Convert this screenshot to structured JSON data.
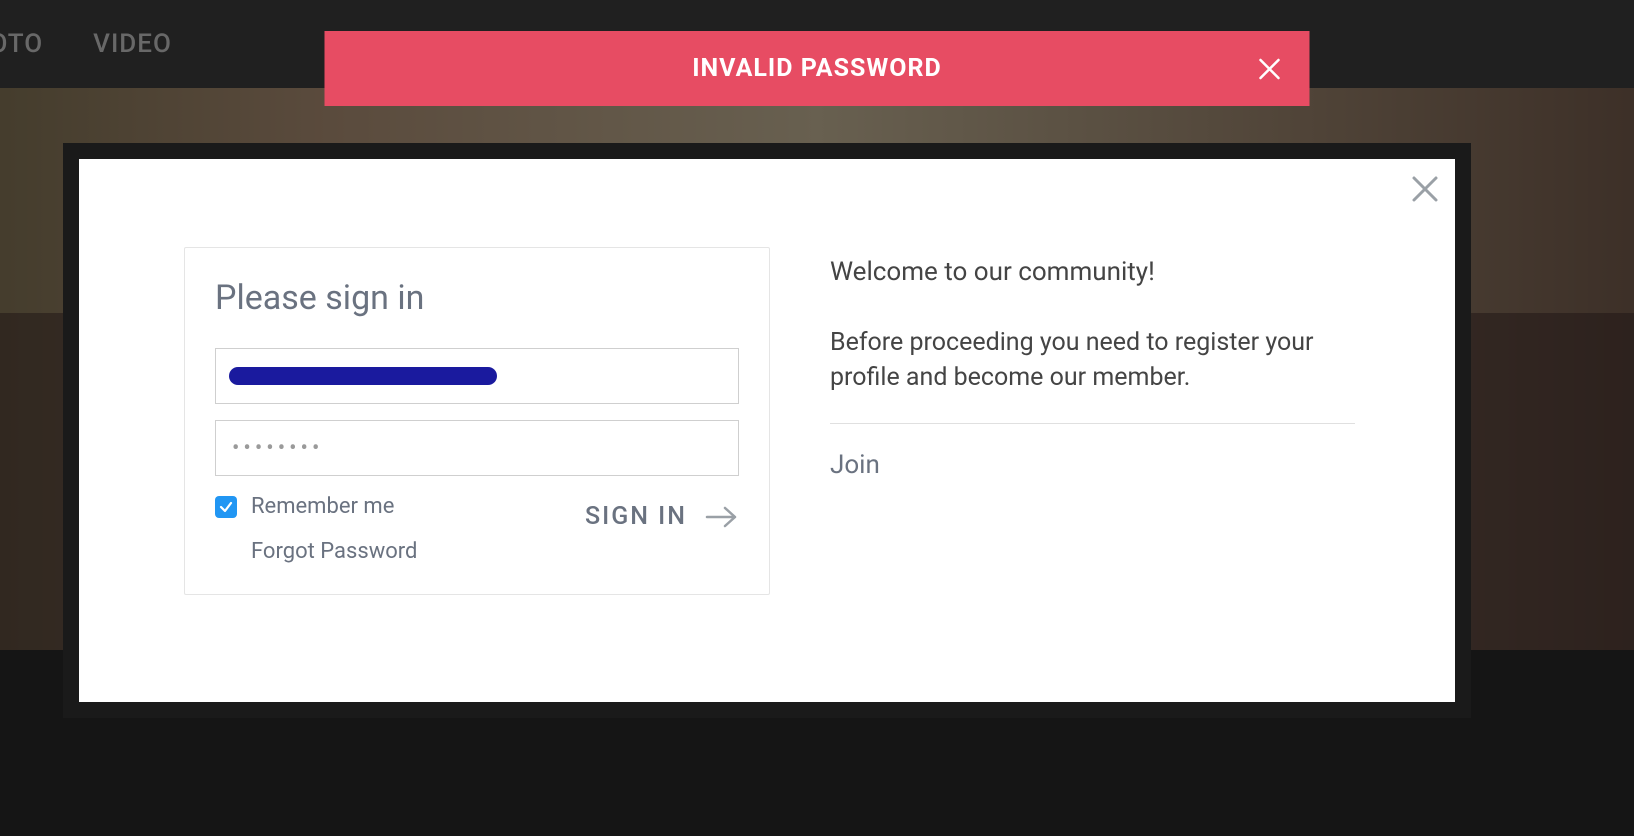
{
  "nav": {
    "photo": "HOTO",
    "video": "VIDEO"
  },
  "error": {
    "message": "INVALID PASSWORD"
  },
  "signin": {
    "title": "Please sign in",
    "email_value": "",
    "password_display": "••••••••",
    "remember_label": "Remember me",
    "remember_checked": true,
    "forgot_label": "Forgot Password",
    "submit_label": "SIGN IN"
  },
  "welcome": {
    "title": "Welcome to our community!",
    "body": "Before proceeding you need to register your profile and become our member.",
    "join_label": "Join"
  }
}
